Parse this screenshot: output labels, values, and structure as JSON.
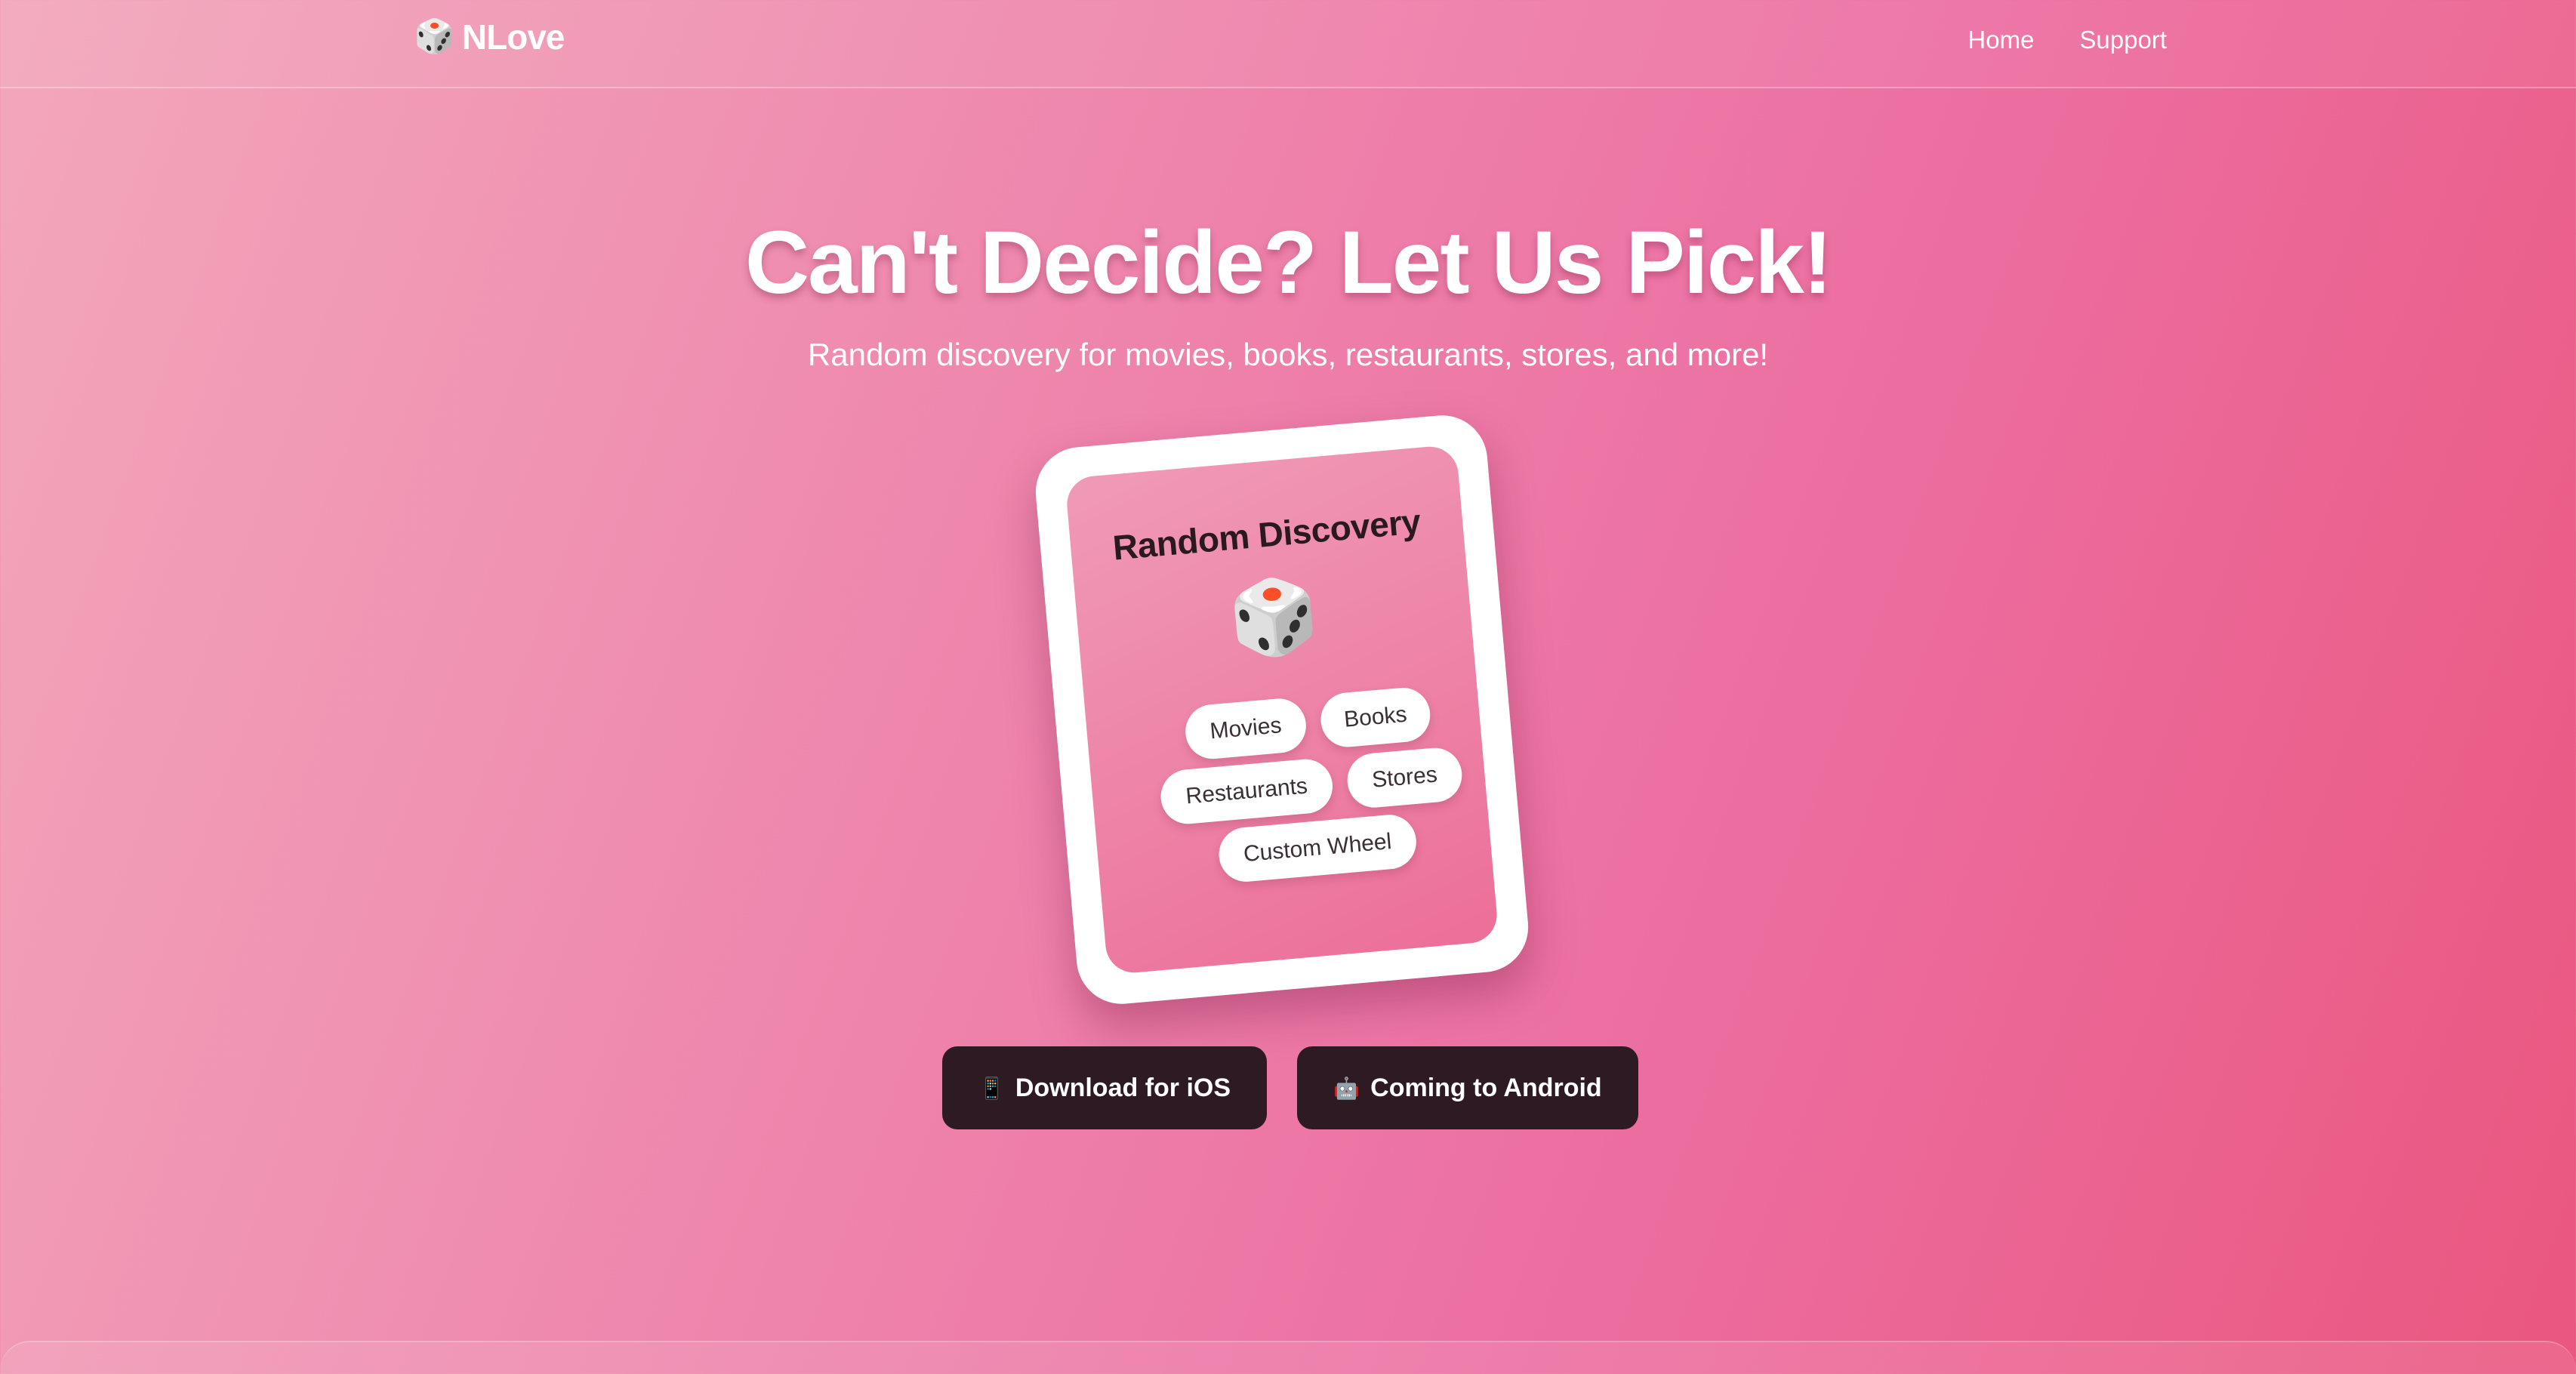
{
  "nav": {
    "brand_icon": "🎲",
    "brand_name": "NLove",
    "links": [
      {
        "label": "Home"
      },
      {
        "label": "Support"
      }
    ]
  },
  "hero": {
    "title": "Can't Decide? Let Us Pick!",
    "subtitle": "Random discovery for movies, books, restaurants, stores, and more!"
  },
  "phone_mockup": {
    "title": "Random Discovery",
    "icon": "🎲",
    "categories": [
      {
        "label": "Movies"
      },
      {
        "label": "Books"
      },
      {
        "label": "Restaurants"
      },
      {
        "label": "Stores"
      },
      {
        "label": "Custom Wheel"
      }
    ]
  },
  "actions": {
    "ios": {
      "icon": "📱",
      "label": "Download for iOS"
    },
    "android": {
      "icon": "🤖",
      "label": "Coming to Android"
    }
  },
  "colors": {
    "gradient_start": "#f3a7bb",
    "gradient_end": "#ea577f",
    "button_bg": "#2e1a22",
    "text_light": "#ffffff"
  }
}
